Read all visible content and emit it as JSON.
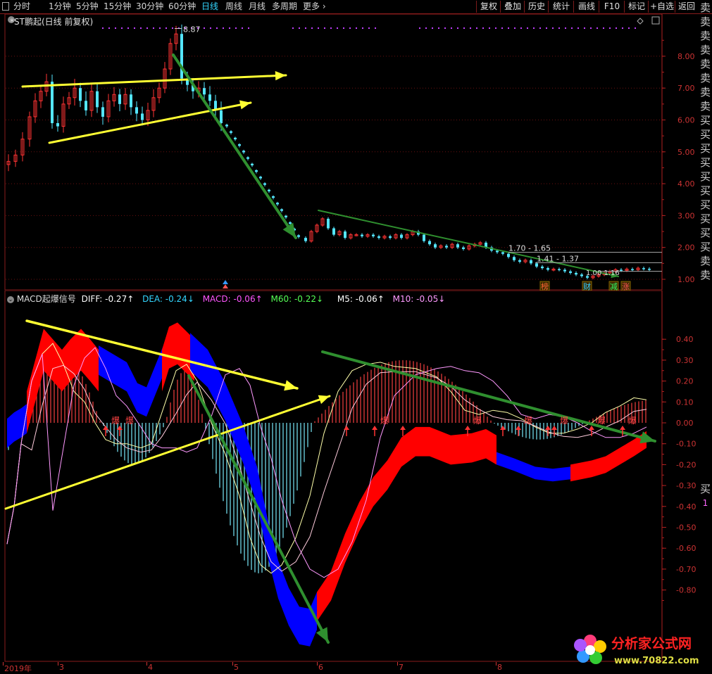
{
  "toolbar": {
    "periods": [
      "分时",
      "1分钟",
      "5分钟",
      "15分钟",
      "30分钟",
      "60分钟",
      "日线",
      "周线",
      "月线",
      "多周期",
      "更多"
    ],
    "active_period": "日线",
    "right_buttons": [
      "复权",
      "叠加",
      "历史",
      "统计",
      "画线",
      "F10",
      "标记",
      "+自选",
      "返回"
    ]
  },
  "main_chart": {
    "title": "*ST鹏起(日线 前复权)",
    "price_axis": [
      "8.00",
      "7.00",
      "6.00",
      "5.00",
      "4.00",
      "3.00",
      "2.00",
      "1.00"
    ],
    "high_label": "8.87",
    "zones": [
      "1.70 - 1.65",
      "1.41 - 1.37"
    ],
    "low_label": "1.00 1.16",
    "badges": [
      "榜",
      "财",
      "减",
      "涨"
    ]
  },
  "macd_chart": {
    "title": "MACD起爆信号",
    "indicators": {
      "diff": "DIFF: -0.27↑",
      "dea": "DEA: -0.24↓",
      "macd": "MACD: -0.06↑",
      "m60": "M60: -0.22↓",
      "m5": "M5: -0.06↑",
      "m10": "M10: -0.05↓"
    },
    "axis": [
      "0.40",
      "0.30",
      "0.20",
      "0.10",
      "0.00",
      "-0.10",
      "-0.20",
      "-0.30",
      "-0.40",
      "-0.50",
      "-0.60",
      "-0.70",
      "-0.80"
    ],
    "signal_label": "爆",
    "colors": {
      "diff": "#ffffff",
      "dea": "#ffff66",
      "macd": "#ff66ff",
      "m60": "#66ff66",
      "m5": "#ffffff",
      "m10": "#ff99ff",
      "band_up": "#ff0000",
      "band_down": "#0000ff"
    }
  },
  "xaxis": {
    "labels": [
      "2019年",
      "3",
      "4",
      "5",
      "6",
      "7",
      "8"
    ]
  },
  "sidebar": {
    "main_signals": [
      "卖",
      "卖",
      "卖",
      "卖",
      "卖",
      "卖",
      "卖",
      "卖",
      "买",
      "买",
      "买",
      "买",
      "买",
      "买",
      "买",
      "买",
      "买",
      "买",
      "卖",
      "卖"
    ],
    "macd_signal": "买",
    "macd_count": "1"
  },
  "watermark": {
    "title": "分析家公式网",
    "url": "www.70822.com"
  }
}
